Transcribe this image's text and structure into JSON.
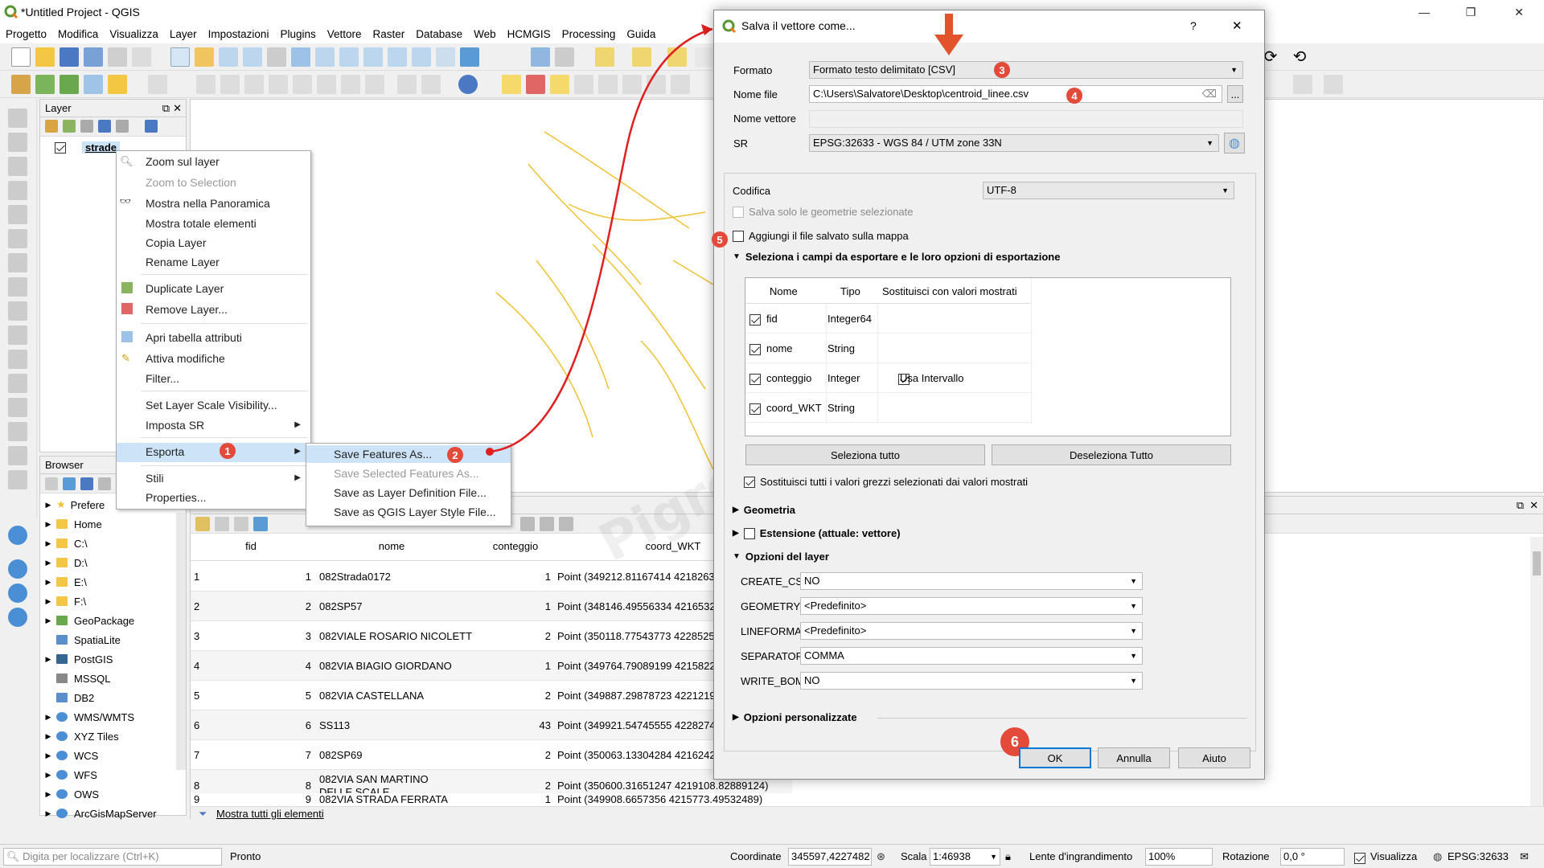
{
  "window": {
    "title": "*Untitled Project - QGIS",
    "min": "—",
    "max": "❐",
    "close": "✕"
  },
  "menubar": [
    "Progetto",
    "Modifica",
    "Visualizza",
    "Layer",
    "Impostazioni",
    "Plugins",
    "Vettore",
    "Raster",
    "Database",
    "Web",
    "HCMGIS",
    "Processing",
    "Guida"
  ],
  "layers_panel": {
    "title": "Layer",
    "layer_name": "strade"
  },
  "browser_panel": {
    "title": "Browser",
    "items": [
      "Prefere",
      "Home",
      "C:\\",
      "D:\\",
      "E:\\",
      "F:\\",
      "GeoPackage",
      "SpatiaLite",
      "PostGIS",
      "MSSQL",
      "DB2",
      "WMS/WMTS",
      "XYZ Tiles",
      "WCS",
      "WFS",
      "OWS",
      "ArcGisMapServer"
    ]
  },
  "context_menu": {
    "items": [
      "Zoom sul layer",
      "Zoom to Selection",
      "Mostra nella Panoramica",
      "Mostra totale elementi",
      "Copia Layer",
      "Rename Layer",
      "Duplicate Layer",
      "Remove Layer...",
      "Apri tabella attributi",
      "Attiva modifiche",
      "Filter...",
      "Set Layer Scale Visibility...",
      "Imposta SR",
      "Esporta",
      "Stili",
      "Properties..."
    ]
  },
  "submenu": {
    "items": [
      "Save Features As...",
      "Save Selected Features As...",
      "Save as Layer Definition File...",
      "Save as QGIS Layer Style File..."
    ]
  },
  "badges": [
    "1",
    "2",
    "3",
    "4",
    "5",
    "6"
  ],
  "dialog": {
    "title": "Salva il vettore come...",
    "help": "?",
    "close": "✕",
    "formato_label": "Formato",
    "formato_value": "Formato testo delimitato [CSV]",
    "nomefile_label": "Nome file",
    "nomefile_value": "C:\\Users\\Salvatore\\Desktop\\centroid_linee.csv",
    "browse": "...",
    "nomevettore_label": "Nome vettore",
    "sr_label": "SR",
    "sr_value": "EPSG:32633 - WGS 84 / UTM zone 33N",
    "codifica_label": "Codifica",
    "codifica_value": "UTF-8",
    "salva_solo": "Salva solo le geometrie selezionate",
    "aggiungi": "Aggiungi il file salvato sulla mappa",
    "seleziona_campi": "Seleziona i campi da esportare e le loro opzioni di esportazione",
    "fields_headers": [
      "Nome",
      "Tipo",
      "Sostituisci con valori mostrati"
    ],
    "fields": [
      {
        "name": "fid",
        "type": "Integer64",
        "replace": ""
      },
      {
        "name": "nome",
        "type": "String",
        "replace": ""
      },
      {
        "name": "conteggio",
        "type": "Integer",
        "replace": "Usa Intervallo"
      },
      {
        "name": "coord_WKT",
        "type": "String",
        "replace": ""
      }
    ],
    "seleziona_tutto": "Seleziona tutto",
    "deseleziona_tutto": "Deseleziona Tutto",
    "sostituisci_tutti": "Sostituisci tutti i valori grezzi selezionati dai valori mostrati",
    "geometria": "Geometria",
    "estensione": "Estensione (attuale: vettore)",
    "opzioni_layer": "Opzioni del layer",
    "layer_options": [
      {
        "key": "CREATE_CSVT",
        "value": "NO"
      },
      {
        "key": "GEOMETRY",
        "value": "<Predefinito>"
      },
      {
        "key": "LINEFORMAT",
        "value": "<Predefinito>"
      },
      {
        "key": "SEPARATOR",
        "value": "COMMA"
      },
      {
        "key": "WRITE_BOM",
        "value": "NO"
      }
    ],
    "opzioni_personalizzate": "Opzioni personalizzate",
    "ok": "OK",
    "annulla": "Annulla",
    "aiuto": "Aiuto"
  },
  "attribute_table": {
    "headers": [
      "fid",
      "nome",
      "conteggio",
      "coord_WKT"
    ],
    "rows": [
      {
        "n": "1",
        "fid": "1",
        "nome": "082Strada0172",
        "conteggio": "1",
        "wkt": "Point (349212.81167414 4218263"
      },
      {
        "n": "2",
        "fid": "2",
        "nome": "082SP57",
        "conteggio": "1",
        "wkt": "Point (348146.49556334 4216532"
      },
      {
        "n": "3",
        "fid": "3",
        "nome": "082VIALE ROSARIO NICOLETTI",
        "conteggio": "2",
        "wkt": "Point (350118.77543773 4228525"
      },
      {
        "n": "4",
        "fid": "4",
        "nome": "082VIA BIAGIO GIORDANO",
        "conteggio": "1",
        "wkt": "Point (349764.79089199 4215822"
      },
      {
        "n": "5",
        "fid": "5",
        "nome": "082VIA CASTELLANA",
        "conteggio": "2",
        "wkt": "Point (349887.29878723 4221219"
      },
      {
        "n": "6",
        "fid": "6",
        "nome": "SS113",
        "conteggio": "43",
        "wkt": "Point (349921.54745555 4228274"
      },
      {
        "n": "7",
        "fid": "7",
        "nome": "082SP69",
        "conteggio": "2",
        "wkt": "Point (350063.13304284 4216242"
      },
      {
        "n": "8",
        "fid": "8",
        "nome": "082VIA SAN MARTINO DELLE SCALE",
        "conteggio": "2",
        "wkt": "Point (350600.31651247 4219108.82889124)"
      },
      {
        "n": "9",
        "fid": "9",
        "nome": "082VIA STRADA FERRATA",
        "conteggio": "1",
        "wkt": "Point (349908.6657356 4215773.49532489)"
      }
    ],
    "show_all": "Mostra tutti gli elementi"
  },
  "statusbar": {
    "search_placeholder": "Digita per localizzare (Ctrl+K)",
    "pronto": "Pronto",
    "coord_label": "Coordinate",
    "coord_value": "345597,4227482",
    "scala_label": "Scala",
    "scala_value": "1:46938",
    "lente_label": "Lente d'ingrandimento",
    "lente_value": "100%",
    "rotazione_label": "Rotazione",
    "rotazione_value": "0,0 °",
    "visualizza": "Visualizza",
    "epsg": "EPSG:32633"
  },
  "watermark": "Pigrecoinfinito",
  "colors": {
    "accent_red": "#e34a3a",
    "qgis_green": "#589632",
    "selection": "#cde3f7",
    "map_line": "#f1c232"
  }
}
